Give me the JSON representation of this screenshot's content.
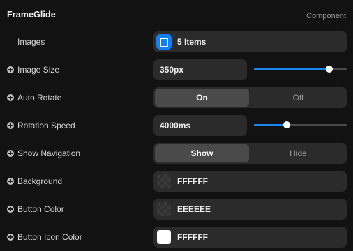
{
  "header": {
    "title": "FrameGlide",
    "kind": "Component"
  },
  "rows": {
    "images": {
      "label": "Images",
      "value": "5 Items",
      "icon": "array-brackets-icon",
      "icon_color": "#1280f5"
    },
    "image_size": {
      "label": "Image Size",
      "value": "350px",
      "slider_fraction": 0.81
    },
    "auto_rotate": {
      "label": "Auto Rotate",
      "options": [
        "On",
        "Off"
      ],
      "selected": "On"
    },
    "rotation_speed": {
      "label": "Rotation Speed",
      "value": "4000ms",
      "slider_fraction": 0.35
    },
    "show_navigation": {
      "label": "Show Navigation",
      "options": [
        "Show",
        "Hide"
      ],
      "selected": "Show"
    },
    "background": {
      "label": "Background",
      "value": "FFFFFF",
      "swatch": "transparent-checker"
    },
    "button_color": {
      "label": "Button Color",
      "value": "EEEEEE",
      "swatch": "transparent-checker"
    },
    "button_icon_color": {
      "label": "Button Icon Color",
      "value": "FFFFFF",
      "swatch": "#ffffff"
    }
  },
  "colors": {
    "accent": "#1a86f3",
    "panel_background": "#121212",
    "field_background": "#2b2b2b",
    "segment_active": "#4a4a4a"
  }
}
